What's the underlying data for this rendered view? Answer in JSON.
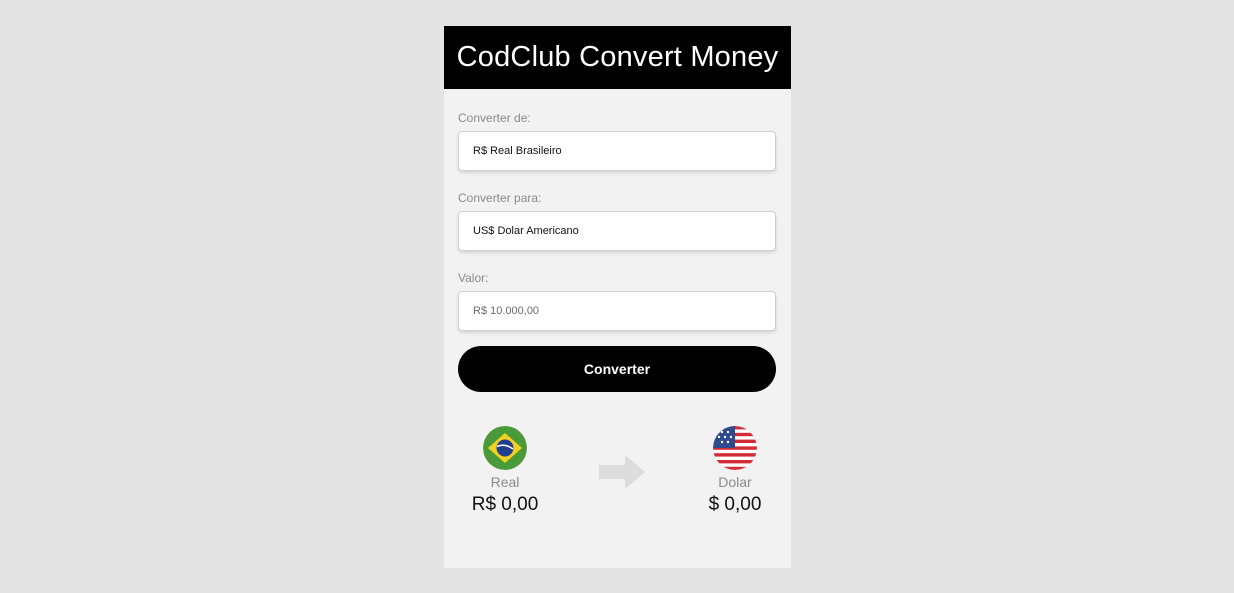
{
  "header": {
    "title": "CodClub Convert Money"
  },
  "form": {
    "from_label": "Converter de:",
    "from_selected": "R$ Real Brasileiro",
    "to_label": "Converter para:",
    "to_selected": "US$ Dolar Americano",
    "value_label": "Valor:",
    "value_placeholder": "R$ 10.000,00",
    "convert_button": "Converter"
  },
  "result": {
    "from_currency_name": "Real",
    "from_value": "R$ 0,00",
    "from_icon": "brazil-flag-icon",
    "to_currency_name": "Dolar",
    "to_value": "$ 0,00",
    "to_icon": "usa-flag-icon",
    "arrow_icon": "arrow-right-icon"
  },
  "colors": {
    "header_bg": "#000000",
    "card_bg": "#f2f2f2",
    "page_bg": "#e4e4e4",
    "button_bg": "#000000"
  }
}
